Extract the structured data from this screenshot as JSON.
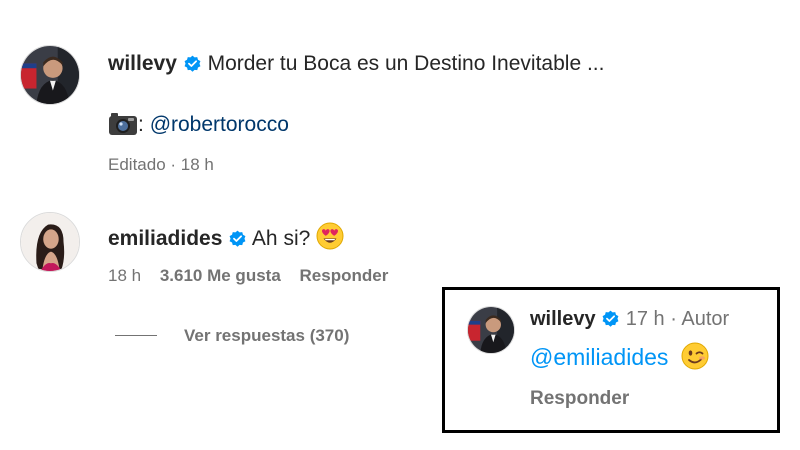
{
  "colors": {
    "text": "#262626",
    "muted": "#737373",
    "mention": "#00376b",
    "mention_bright": "#0095f6",
    "verified": "#0095f6",
    "box_border": "#000000"
  },
  "post": {
    "username": "willevy",
    "caption": "Morder tu Boca es un Destino Inevitable ...",
    "credit_icon": "camera-emoji",
    "credit_prefix": ":",
    "credit_mention": "@robertorocco",
    "meta": "Editado · 18 h"
  },
  "comment": {
    "username": "emiliadides",
    "text": "Ah si?",
    "emoji": "heart-eyes-emoji",
    "time": "18 h",
    "likes": "3.610 Me gusta",
    "reply_label": "Responder",
    "view_replies": "Ver respuestas (370)"
  },
  "reply": {
    "username": "willevy",
    "time": "17 h",
    "separator": "·",
    "author_tag": "Autor",
    "mention": "@emiliadides",
    "emoji": "winking-face-emoji",
    "reply_label": "Responder"
  }
}
